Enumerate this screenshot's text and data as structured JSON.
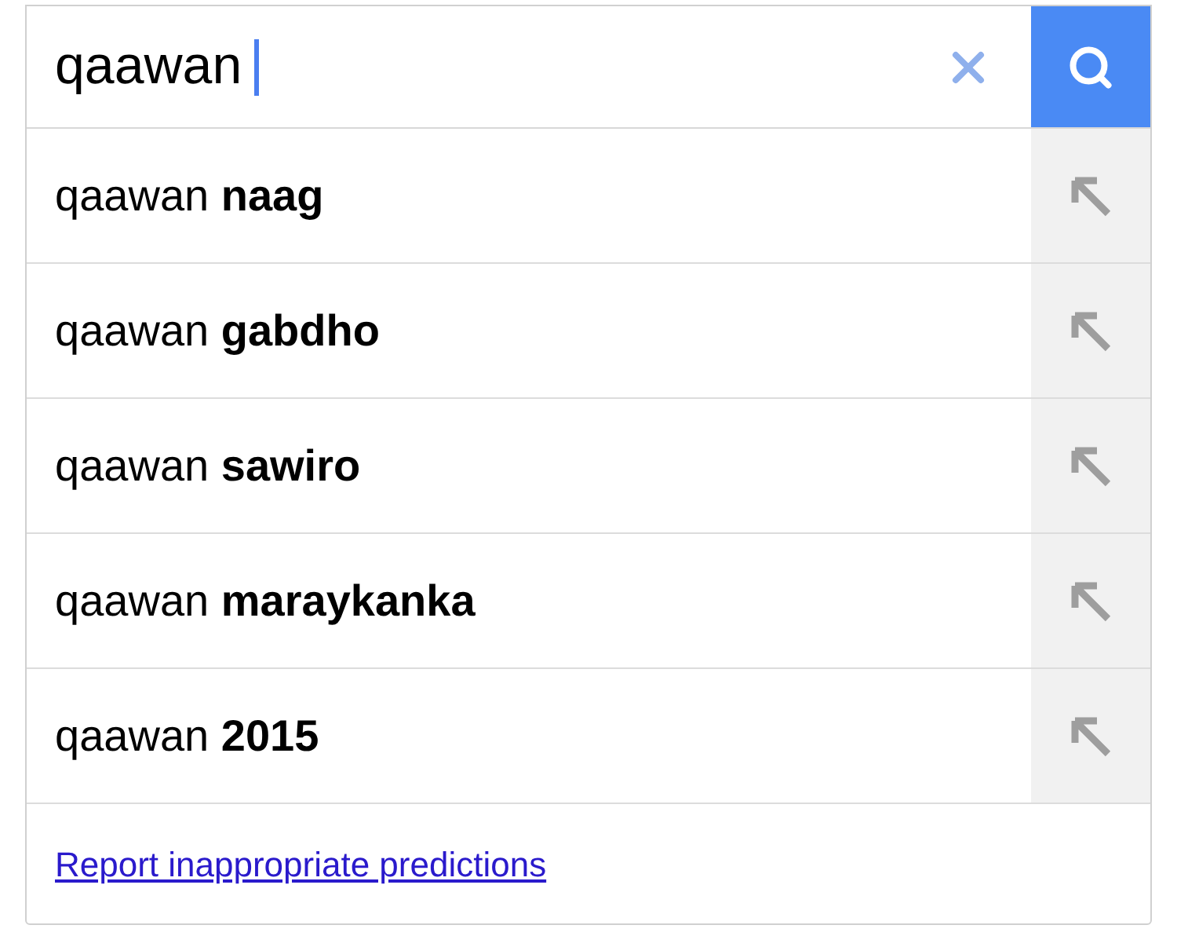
{
  "search": {
    "value": "qaawan"
  },
  "suggestions": [
    {
      "text": "qaawan **naag**"
    },
    {
      "text": "qaawan **gabdho**"
    },
    {
      "text": "qaawan **sawiro**"
    },
    {
      "text": "qaawan **maraykanka**"
    },
    {
      "text": "qaawan **2015**"
    }
  ],
  "footer": {
    "link": "Report inappropriate predictions"
  }
}
